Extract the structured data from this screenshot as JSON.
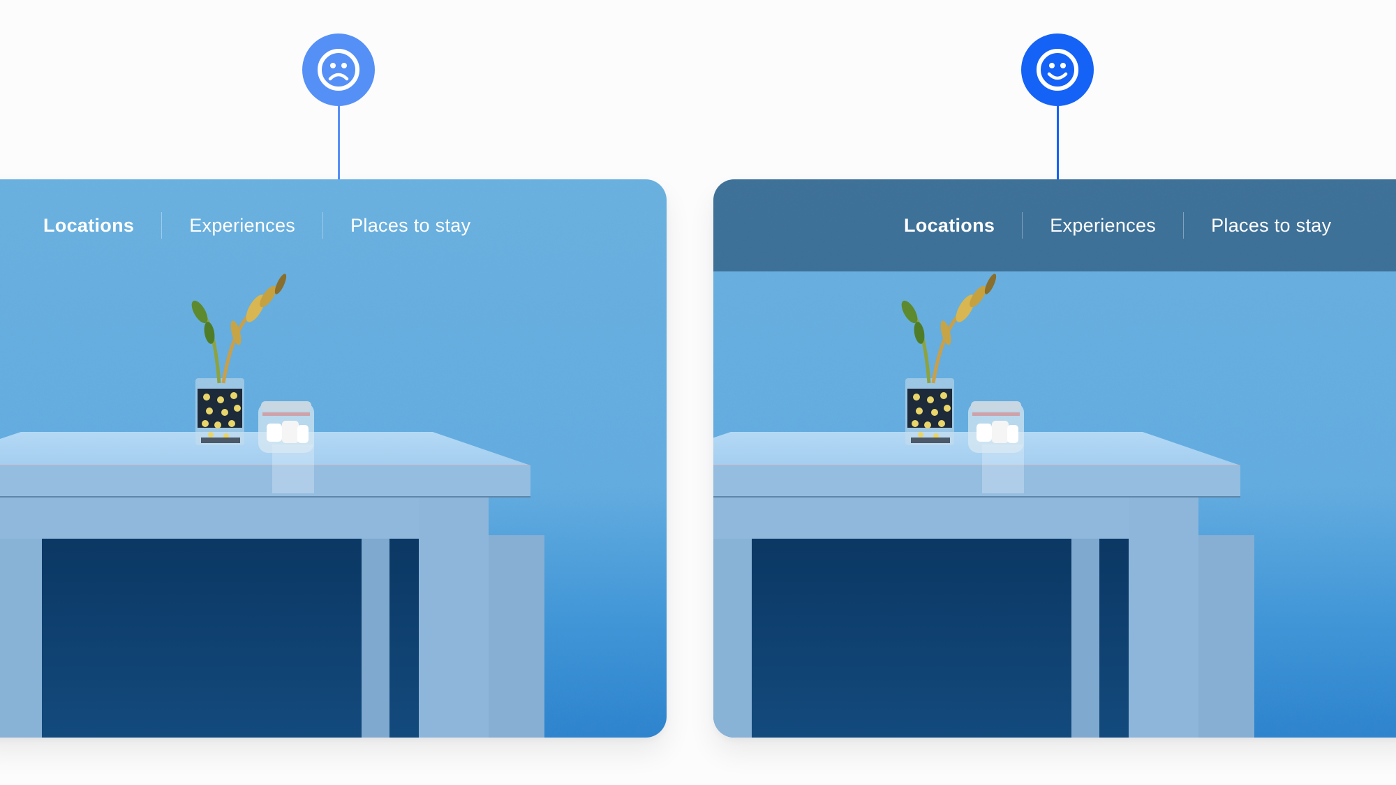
{
  "pins": {
    "left": {
      "icon": "sad-face-icon",
      "color": "#5590f7",
      "meaning": "bad example"
    },
    "right": {
      "icon": "happy-face-icon",
      "color": "#1562f6",
      "meaning": "good example"
    }
  },
  "cards": {
    "left": {
      "nav": [
        {
          "label": "Locations",
          "active": true
        },
        {
          "label": "Experiences",
          "active": false
        },
        {
          "label": "Places to stay",
          "active": false
        }
      ],
      "nav_background": "none"
    },
    "right": {
      "nav": [
        {
          "label": "Locations",
          "active": true
        },
        {
          "label": "Experiences",
          "active": false
        },
        {
          "label": "Places to stay",
          "active": false
        }
      ],
      "nav_background": "dark translucent overlay"
    }
  },
  "photo": {
    "description": "Light blue table with a plant in a floral glass and a small glass jar against a blue textured wall",
    "colors": {
      "wall": "#6db4e3",
      "wall_deep": "#2f86d0",
      "table_top": "#a9d3f2",
      "table_side": "#8db6d8",
      "shadow": "#0f3e6b"
    }
  }
}
